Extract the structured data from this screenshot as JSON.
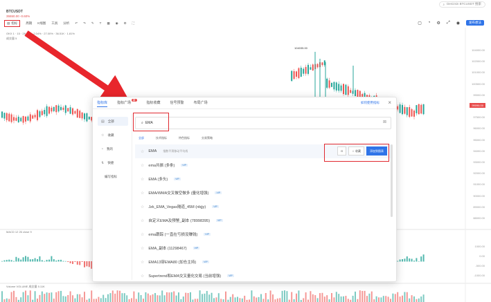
{
  "topbar": {
    "search_text": "Denizsin BTCUSDT 搜索"
  },
  "symbol": {
    "title": "BTCUSDT",
    "sub": "35550.00 -0.60%"
  },
  "toolbar": {
    "items": [
      "指标",
      "周期",
      "K线图",
      "工具",
      "分析"
    ],
    "right_button": "发布想法",
    "colors": {
      "highlight": "#e0282e",
      "accent": "#2f74e8"
    }
  },
  "indicator_lines": {
    "line1": "OKX 1 · 15 · 28 · 35 · 2.04% · 27.00% · 36.51K · 1.81%",
    "line2": "成交量 5",
    "macd": "MACD 12 26 close 9",
    "volume": "Volume VOLUME 成交量 5.11K"
  },
  "price_axis": [
    "104000.00",
    "102000.00",
    "101000.00",
    "100500.00",
    "99000.00",
    "98000.00",
    "97500.00",
    "96000.00",
    "95000.00",
    "94000.00",
    "93000.00",
    "92000.00",
    "91000.00",
    "90000.00",
    "89000.00",
    "88000.00"
  ],
  "price_tag": "99096.00",
  "high_tag": "104035.00",
  "osc_axis": [
    "1000.00",
    "0.00",
    "-500.00",
    "-1000.00"
  ],
  "dialog": {
    "tabs": [
      {
        "label": "指标库",
        "active": true
      },
      {
        "label": "指标广场",
        "badge": "新"
      },
      {
        "label": "指标收藏"
      },
      {
        "label": "信号预警"
      },
      {
        "label": "布局广场"
      }
    ],
    "help": "如何使用指标",
    "close": "×",
    "sidebar": [
      {
        "icon": "▤",
        "label": "全部",
        "active": true
      },
      {
        "icon": "☆",
        "label": "收藏"
      },
      {
        "icon": "◔",
        "label": "我的"
      },
      {
        "icon": "↯",
        "label": "快捷"
      },
      {
        "icon": "",
        "label": "编写指标"
      }
    ],
    "search": {
      "value": "EMA",
      "clear": "⊠"
    },
    "filters": [
      "全部",
      "技术指标",
      "特色指标",
      "交易策略"
    ],
    "results": [
      {
        "name": "EMA",
        "desc": "指数平滑移动平均线",
        "tag": "",
        "hover": true
      },
      {
        "name": "ema共振 (多条)",
        "desc": "",
        "tag": "VIP"
      },
      {
        "name": "EMA (多头)",
        "desc": "",
        "tag": "VIP"
      },
      {
        "name": "EMA/WMA交叉做空做多 (量化增强)",
        "desc": "",
        "tag": "VIP"
      },
      {
        "name": "Jzk_EMA_Vegas隧道_45M (nbjjy)",
        "desc": "",
        "tag": "VIP"
      },
      {
        "name": "自定义EMA及预警_副本 (78998395)",
        "desc": "",
        "tag": "VIP"
      },
      {
        "name": "ema跟踪 (一直在亏损没赚钱)",
        "desc": "",
        "tag": "VIP"
      },
      {
        "name": "EMA_副本 (11298467)",
        "desc": "",
        "tag": "VIP"
      },
      {
        "name": "EMA13穿EMA80 (加仓主持)",
        "desc": "",
        "tag": "VIP"
      },
      {
        "name": "Supertrend和EMA交叉量化交易 (当前增强)",
        "desc": "",
        "tag": "VIP"
      }
    ],
    "actions": {
      "preview": "⊡",
      "fav": "☆ 收藏",
      "add": "添加到图表"
    }
  }
}
